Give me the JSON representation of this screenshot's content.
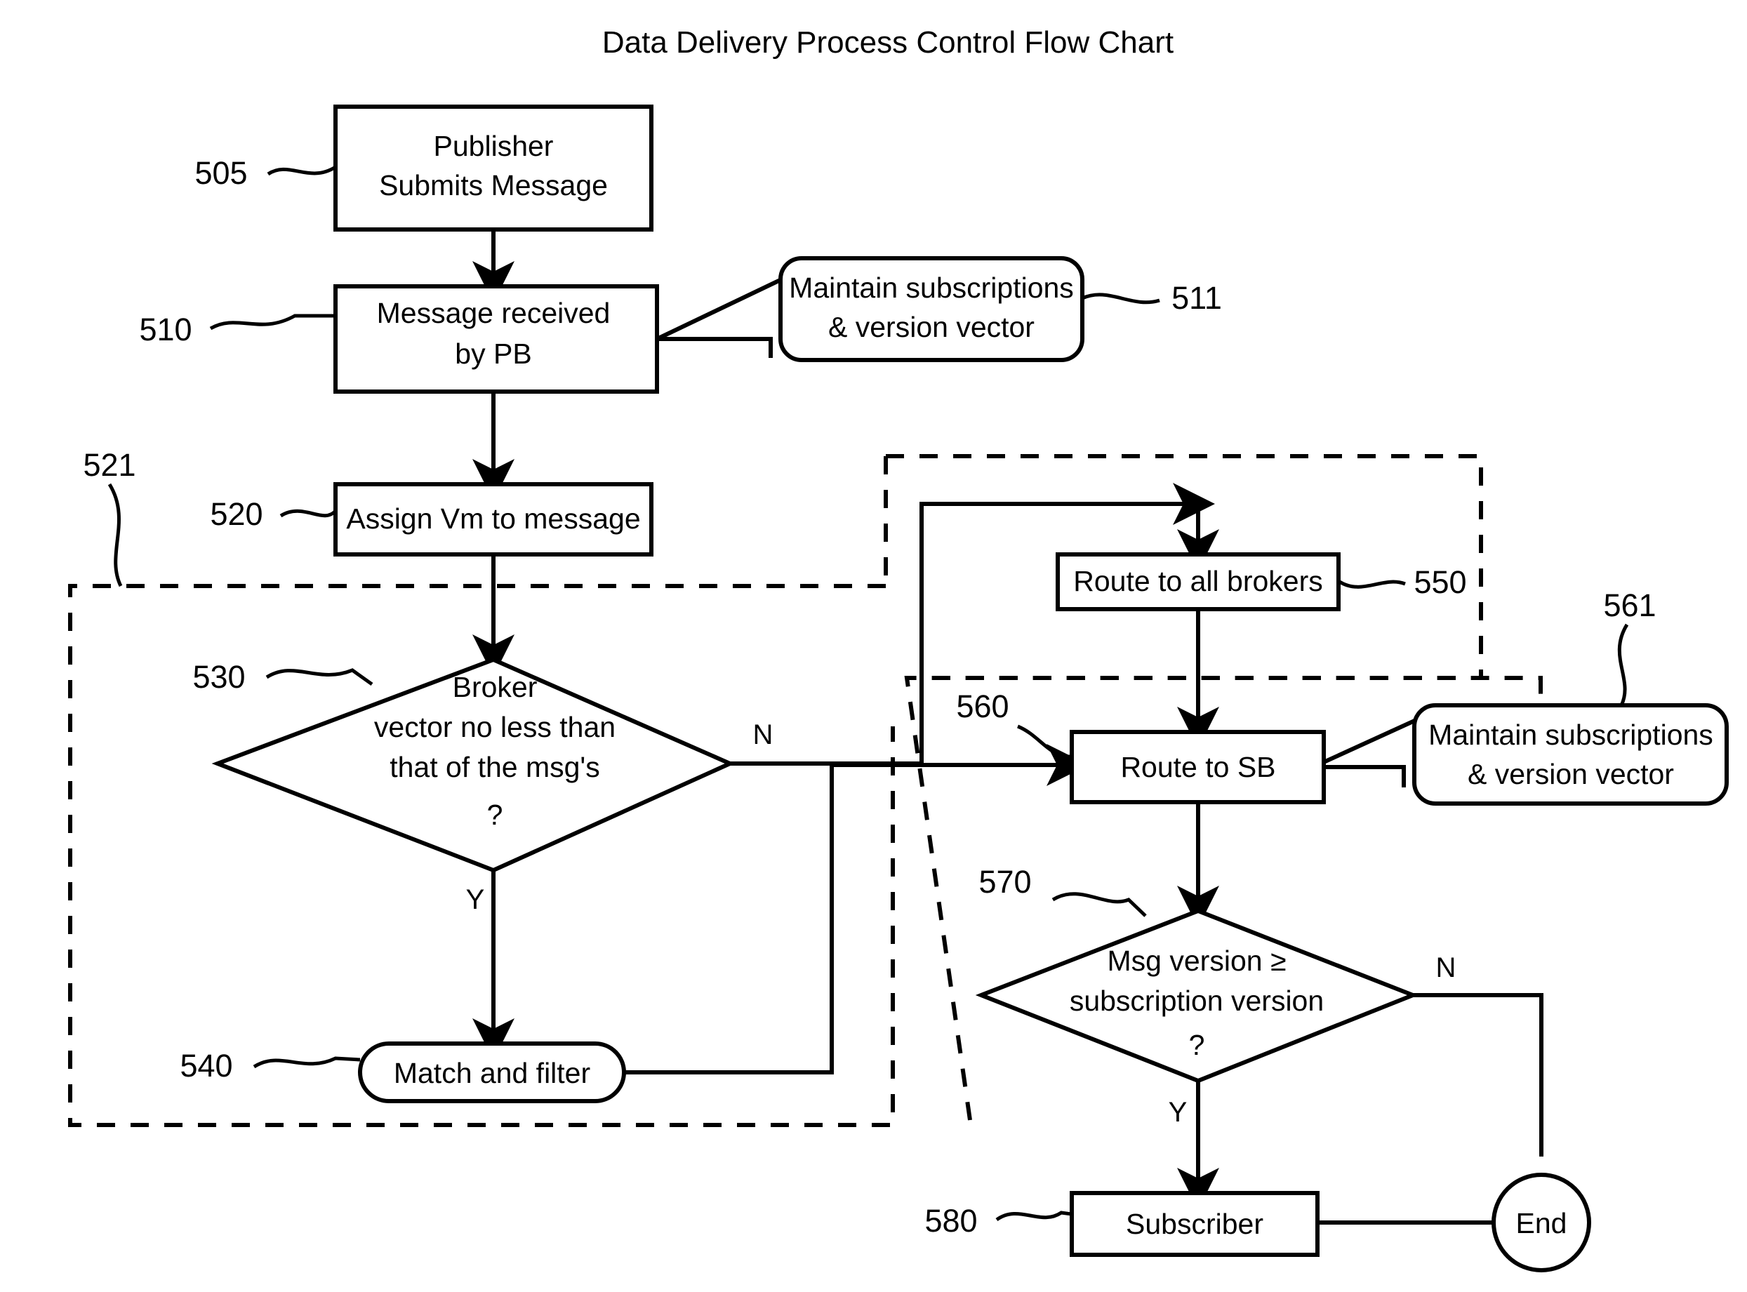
{
  "title": "Data Delivery Process Control Flow Chart",
  "nodes": {
    "publisher": {
      "ref": "505",
      "line1": "Publisher",
      "line2": "Submits Message"
    },
    "message_received": {
      "ref": "510",
      "line1": "Message received",
      "line2": "by PB"
    },
    "maintain_pb": {
      "ref": "511",
      "line1": "Maintain subscriptions",
      "line2": "& version vector"
    },
    "assign_vm": {
      "ref": "520",
      "line1": "Assign Vm to message"
    },
    "broker_decision": {
      "ref": "530",
      "line1": "Broker",
      "line2": "vector no less than",
      "line3": "that of the msg's",
      "line4": "?"
    },
    "match_filter": {
      "ref": "540",
      "line1": "Match and filter"
    },
    "route_all_brokers": {
      "ref": "550",
      "line1": "Route to all brokers"
    },
    "route_sb": {
      "ref": "560",
      "line1": "Route to SB"
    },
    "maintain_sb": {
      "ref": "561",
      "line1": "Maintain subscriptions",
      "line2": "& version vector"
    },
    "version_decision": {
      "ref": "570",
      "line1": "Msg version ≥",
      "line2": "subscription version",
      "line3": "?"
    },
    "subscriber": {
      "ref": "580",
      "line1": "Subscriber"
    },
    "end": {
      "line1": "End"
    }
  },
  "regions": {
    "pb_region": {
      "ref": "521"
    },
    "broker_region": {
      "ref": ""
    },
    "sb_region": {
      "ref": ""
    }
  },
  "branch_labels": {
    "broker_no": "N",
    "broker_yes": "Y",
    "version_no": "N",
    "version_yes": "Y"
  },
  "chart_data": {
    "type": "flowchart",
    "title": "Data Delivery Process Control Flow Chart",
    "steps": [
      {
        "id": "505",
        "label": "Publisher Submits Message",
        "shape": "rect"
      },
      {
        "id": "510",
        "label": "Message received by PB",
        "shape": "rect"
      },
      {
        "id": "511",
        "label": "Maintain subscriptions & version vector",
        "shape": "rounded-rect"
      },
      {
        "id": "520",
        "label": "Assign Vm to message",
        "shape": "rect"
      },
      {
        "id": "530",
        "label": "Broker vector no less than that of the msg's ?",
        "shape": "diamond"
      },
      {
        "id": "540",
        "label": "Match and filter",
        "shape": "stadium"
      },
      {
        "id": "550",
        "label": "Route to all brokers",
        "shape": "rect"
      },
      {
        "id": "560",
        "label": "Route to SB",
        "shape": "rect"
      },
      {
        "id": "561",
        "label": "Maintain subscriptions & version vector",
        "shape": "rounded-rect"
      },
      {
        "id": "570",
        "label": "Msg version ≥ subscription version ?",
        "shape": "diamond"
      },
      {
        "id": "580",
        "label": "Subscriber",
        "shape": "rect"
      },
      {
        "id": "end",
        "label": "End",
        "shape": "circle"
      }
    ],
    "edges": [
      {
        "from": "505",
        "to": "510",
        "label": ""
      },
      {
        "from": "511",
        "to": "510",
        "label": ""
      },
      {
        "from": "510",
        "to": "520",
        "label": ""
      },
      {
        "from": "520",
        "to": "530",
        "label": ""
      },
      {
        "from": "530",
        "to": "550",
        "label": "N"
      },
      {
        "from": "530",
        "to": "540",
        "label": "Y"
      },
      {
        "from": "540",
        "to": "560",
        "label": ""
      },
      {
        "from": "550",
        "to": "560",
        "label": ""
      },
      {
        "from": "561",
        "to": "560",
        "label": ""
      },
      {
        "from": "560",
        "to": "570",
        "label": ""
      },
      {
        "from": "570",
        "to": "580",
        "label": "Y"
      },
      {
        "from": "570",
        "to": "end",
        "label": "N"
      },
      {
        "from": "580",
        "to": "end",
        "label": ""
      }
    ],
    "regions": [
      {
        "id": "521",
        "label": "521",
        "style": "dashed"
      },
      {
        "id": "broker-group",
        "label": "",
        "style": "dashed"
      },
      {
        "id": "sb-group",
        "label": "",
        "style": "dashed"
      }
    ]
  }
}
